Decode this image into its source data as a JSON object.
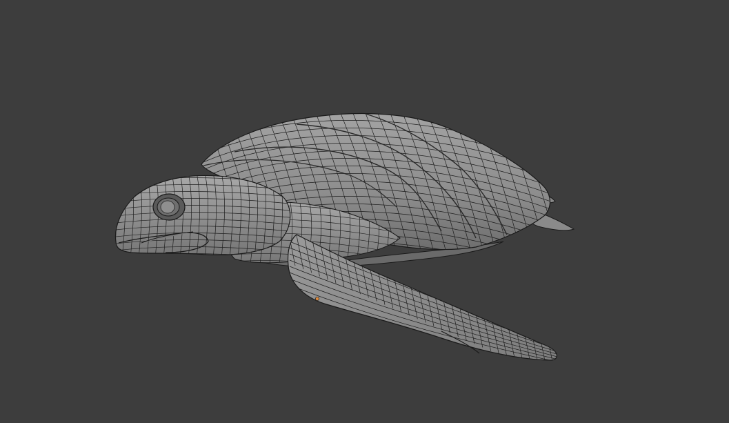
{
  "viewport": {
    "background": "#3d3d3d",
    "mode": "3d-viewport",
    "shading": "solid-with-wireframe"
  },
  "scene": {
    "object_name": "sea turtle mesh",
    "mesh_color": "#8e8e8e",
    "wire_color": "#1a1a1a",
    "origin_color": "#e08a3a"
  }
}
